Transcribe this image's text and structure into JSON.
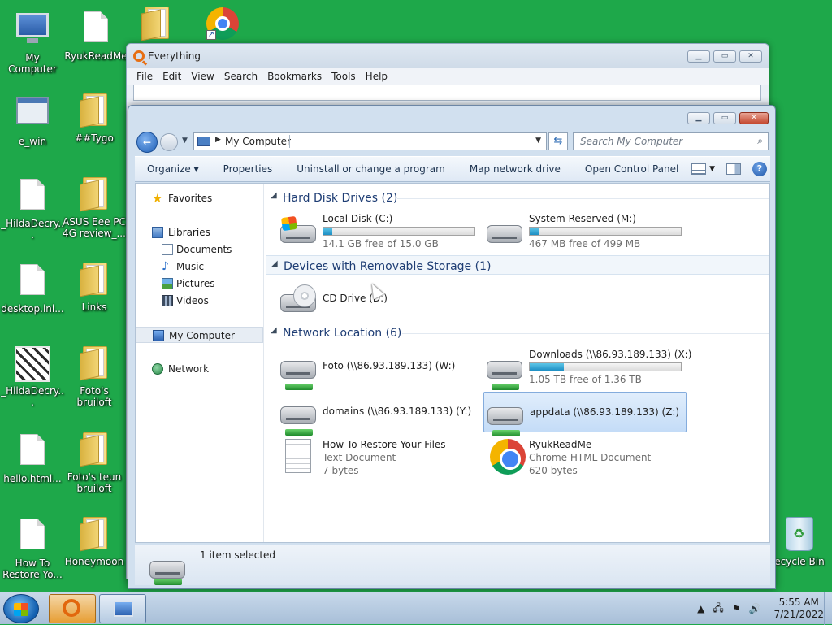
{
  "desktop": {
    "icons": [
      {
        "label": "My Computer",
        "glyph": "computer-icon"
      },
      {
        "label": "RyukReadMe",
        "glyph": "file-icon"
      },
      {
        "label": "e_win",
        "glyph": "window-icon"
      },
      {
        "label": "##Tygo",
        "glyph": "folder-icon"
      },
      {
        "label": "_HildaDecry...",
        "glyph": "file-icon"
      },
      {
        "label": "ASUS Eee PC 4G review_...",
        "glyph": "folder-icon"
      },
      {
        "label": "desktop.ini...",
        "glyph": "file-icon"
      },
      {
        "label": "Links",
        "glyph": "folder-icon"
      },
      {
        "label": "_HildaDecry...",
        "glyph": "pattern-image-icon"
      },
      {
        "label": "Foto's bruiloft",
        "glyph": "folder-icon"
      },
      {
        "label": "hello.html...",
        "glyph": "file-icon"
      },
      {
        "label": "Foto's teun bruiloft",
        "glyph": "folder-icon"
      },
      {
        "label": "How To Restore Yo...",
        "glyph": "text-file-icon"
      },
      {
        "label": "Honeymoon",
        "glyph": "folder-icon"
      },
      {
        "label": "ecycle Bin",
        "glyph": "recycle-bin-icon"
      }
    ]
  },
  "everything": {
    "title": "Everything",
    "menu": [
      "File",
      "Edit",
      "View",
      "Search",
      "Bookmarks",
      "Tools",
      "Help"
    ],
    "search_value": ""
  },
  "explorer": {
    "address": "My Computer",
    "search_placeholder": "Search My Computer",
    "toolbar": {
      "organize": "Organize ▾",
      "properties": "Properties",
      "uninstall": "Uninstall or change a program",
      "map_drive": "Map network drive",
      "control_panel": "Open Control Panel"
    },
    "nav": {
      "favorites": "Favorites",
      "libraries": "Libraries",
      "documents": "Documents",
      "music": "Music",
      "pictures": "Pictures",
      "videos": "Videos",
      "my_computer": "My Computer",
      "network": "Network"
    },
    "groups": {
      "hdd": "Hard Disk Drives (2)",
      "removable": "Devices with Removable Storage (1)",
      "network": "Network Location (6)"
    },
    "drives": [
      {
        "name": "Local Disk (C:)",
        "free": "14.1 GB free of 15.0 GB",
        "used_fraction": 0.06
      },
      {
        "name": "System Reserved (M:)",
        "free": "467 MB free of 499 MB",
        "used_fraction": 0.064
      }
    ],
    "removable": [
      {
        "name": "CD Drive (D:)"
      }
    ],
    "network_items": [
      {
        "name": "Foto (\\\\86.93.189.133) (W:)"
      },
      {
        "name": "Downloads (\\\\86.93.189.133) (X:)",
        "free": "1.05 TB free of 1.36 TB",
        "used_fraction": 0.228
      },
      {
        "name": "domains (\\\\86.93.189.133) (Y:)"
      },
      {
        "name": "appdata (\\\\86.93.189.133) (Z:)",
        "selected": true
      },
      {
        "name": "How To Restore Your Files",
        "type": "Text Document",
        "size": "7 bytes"
      },
      {
        "name": "RyukReadMe",
        "type": "Chrome HTML Document",
        "size": "620 bytes"
      }
    ],
    "status": "1 item selected"
  },
  "taskbar": {
    "time": "5:55 AM",
    "date": "7/21/2022"
  }
}
